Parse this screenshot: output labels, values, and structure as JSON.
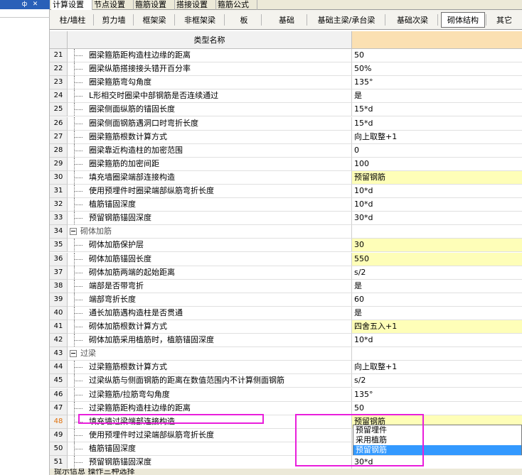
{
  "left_panel": {
    "pin_label": "ф",
    "close_label": "✕"
  },
  "top_tabs": [
    {
      "label": "计算设置",
      "active": true
    },
    {
      "label": "节点设置",
      "active": false
    },
    {
      "label": "箍筋设置",
      "active": false
    },
    {
      "label": "搭接设置",
      "active": false
    },
    {
      "label": "箍筋公式",
      "active": false
    }
  ],
  "sub_tabs": [
    {
      "label": "柱/墙柱",
      "active": false
    },
    {
      "label": "剪力墙",
      "active": false
    },
    {
      "label": "框架梁",
      "active": false
    },
    {
      "label": "非框架梁",
      "active": false
    },
    {
      "label": "板",
      "active": false
    },
    {
      "label": "基础",
      "active": false
    },
    {
      "label": "基础主梁/承台梁",
      "active": false
    },
    {
      "label": "基础次梁",
      "active": false
    },
    {
      "label": "砌体结构",
      "active": true
    },
    {
      "label": "其它",
      "active": false
    }
  ],
  "grid": {
    "header_name": "类型名称",
    "rows": [
      {
        "num": "21",
        "name": "圈梁箍筋距构造柱边缘的距离",
        "value": "50",
        "kind": "item",
        "indent": 1
      },
      {
        "num": "22",
        "name": "圈梁纵筋搭接接头错开百分率",
        "value": "50%",
        "kind": "item",
        "indent": 1
      },
      {
        "num": "23",
        "name": "圈梁箍筋弯勾角度",
        "value": "135°",
        "kind": "item",
        "indent": 1
      },
      {
        "num": "24",
        "name": "L形相交时圈梁中部钢筋是否连续通过",
        "value": "是",
        "kind": "item",
        "indent": 1
      },
      {
        "num": "25",
        "name": "圈梁侧面纵筋的锚固长度",
        "value": "15*d",
        "kind": "item",
        "indent": 1
      },
      {
        "num": "26",
        "name": "圈梁侧面钢筋遇洞口时弯折长度",
        "value": "15*d",
        "kind": "item",
        "indent": 1
      },
      {
        "num": "27",
        "name": "圈梁箍筋根数计算方式",
        "value": "向上取整+1",
        "kind": "item",
        "indent": 1
      },
      {
        "num": "28",
        "name": "圈梁靠近构造柱的加密范围",
        "value": "0",
        "kind": "item",
        "indent": 1
      },
      {
        "num": "29",
        "name": "圈梁箍筋的加密间距",
        "value": "100",
        "kind": "item",
        "indent": 1
      },
      {
        "num": "30",
        "name": "填充墙圈梁端部连接构造",
        "value": "预留钢筋",
        "kind": "item",
        "indent": 1,
        "yellow": true
      },
      {
        "num": "31",
        "name": "使用预埋件时圈梁端部纵筋弯折长度",
        "value": "10*d",
        "kind": "item",
        "indent": 1
      },
      {
        "num": "32",
        "name": "植筋锚固深度",
        "value": "10*d",
        "kind": "item",
        "indent": 1
      },
      {
        "num": "33",
        "name": "预留钢筋锚固深度",
        "value": "30*d",
        "kind": "item",
        "indent": 1
      },
      {
        "num": "34",
        "name": "砌体加筋",
        "value": "",
        "kind": "group"
      },
      {
        "num": "35",
        "name": "砌体加筋保护层",
        "value": "30",
        "kind": "item",
        "indent": 1,
        "yellow": true
      },
      {
        "num": "36",
        "name": "砌体加筋锚固长度",
        "value": "550",
        "kind": "item",
        "indent": 1,
        "yellow": true
      },
      {
        "num": "37",
        "name": "砌体加筋两端的起始距离",
        "value": "s/2",
        "kind": "item",
        "indent": 1
      },
      {
        "num": "38",
        "name": "端部是否带弯折",
        "value": "是",
        "kind": "item",
        "indent": 1
      },
      {
        "num": "39",
        "name": "端部弯折长度",
        "value": "60",
        "kind": "item",
        "indent": 1
      },
      {
        "num": "40",
        "name": "通长加筋遇构造柱是否贯通",
        "value": "是",
        "kind": "item",
        "indent": 1
      },
      {
        "num": "41",
        "name": "砌体加筋根数计算方式",
        "value": "四舍五入+1",
        "kind": "item",
        "indent": 1,
        "yellow": true
      },
      {
        "num": "42",
        "name": "砌体加筋采用植筋时，植筋锚固深度",
        "value": "10*d",
        "kind": "item",
        "indent": 1
      },
      {
        "num": "43",
        "name": "过梁",
        "value": "",
        "kind": "group"
      },
      {
        "num": "44",
        "name": "过梁箍筋根数计算方式",
        "value": "向上取整+1",
        "kind": "item",
        "indent": 1
      },
      {
        "num": "45",
        "name": "过梁纵筋与侧面钢筋的距离在数值范围内不计算侧面钢筋",
        "value": "s/2",
        "kind": "item",
        "indent": 1
      },
      {
        "num": "46",
        "name": "过梁箍筋/拉筋弯勾角度",
        "value": "135°",
        "kind": "item",
        "indent": 1
      },
      {
        "num": "47",
        "name": "过梁箍筋距构造柱边缘的距离",
        "value": "50",
        "kind": "item",
        "indent": 1
      },
      {
        "num": "48",
        "name": "填充墙过梁端部连接构造",
        "value": "预留钢筋",
        "kind": "item",
        "indent": 1,
        "current": true,
        "yellow": true
      },
      {
        "num": "49",
        "name": "使用预埋件时过梁端部纵筋弯折长度",
        "value": "",
        "kind": "item",
        "indent": 1
      },
      {
        "num": "50",
        "name": "植筋锚固深度",
        "value": "",
        "kind": "item",
        "indent": 1
      },
      {
        "num": "51",
        "name": "预留钢筋锚固深度",
        "value": "30*d",
        "kind": "item",
        "indent": 1
      }
    ]
  },
  "dropdown": {
    "options": [
      {
        "label": "预留埋件",
        "selected": false
      },
      {
        "label": "采用植筋",
        "selected": false
      },
      {
        "label": "预留钢筋",
        "selected": true
      }
    ]
  },
  "annotation_color": "#e91edb",
  "status": {
    "text": "提示信息   操作三种选择"
  }
}
